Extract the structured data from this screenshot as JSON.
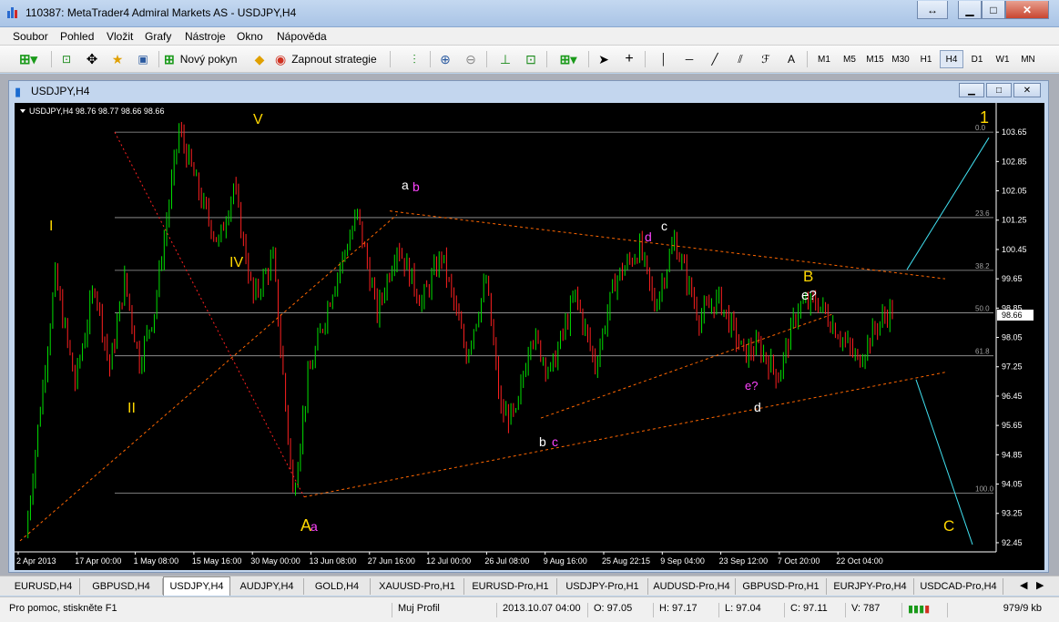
{
  "window": {
    "title": "110387: MetaTrader4 Admiral Markets AS - USDJPY,H4"
  },
  "menu": [
    "Soubor",
    "Pohled",
    "Vložit",
    "Grafy",
    "Nástroje",
    "Okno",
    "Nápověda"
  ],
  "toolbar": {
    "new_order": "Nový pokyn",
    "autotrading": "Zapnout strategie",
    "text_tool": "A",
    "timeframes": [
      "M1",
      "M5",
      "M15",
      "M30",
      "H1",
      "H4",
      "D1",
      "W1",
      "MN"
    ],
    "active_timeframe": "H4"
  },
  "chart_window": {
    "title": "USDJPY,H4"
  },
  "chart_data": {
    "type": "candlestick",
    "header": "USDJPY,H4  98.76 98.77 98.66 98.66",
    "current_price": "98.66",
    "price_ticks": [
      "103.65",
      "102.85",
      "102.05",
      "101.25",
      "100.45",
      "99.65",
      "98.85",
      "98.05",
      "97.25",
      "96.45",
      "95.65",
      "94.85",
      "94.05",
      "93.25",
      "92.45"
    ],
    "ylim": [
      92.2,
      104.2
    ],
    "time_ticks": [
      "2 Apr 2013",
      "17 Apr 00:00",
      "1 May 08:00",
      "15 May 16:00",
      "30 May 00:00",
      "13 Jun 08:00",
      "27 Jun 16:00",
      "12 Jul 00:00",
      "26 Jul 08:00",
      "9 Aug 16:00",
      "25 Aug 22:15",
      "9 Sep 04:00",
      "23 Sep 12:00",
      "7 Oct 20:00",
      "22 Oct 04:00"
    ],
    "fib_levels": [
      {
        "label": "0.0",
        "price": 103.65
      },
      {
        "label": "23.6",
        "price": 101.32
      },
      {
        "label": "38.2",
        "price": 99.88
      },
      {
        "label": "50.0",
        "price": 98.72
      },
      {
        "label": "61.8",
        "price": 97.55
      },
      {
        "label": "100.0",
        "price": 93.8
      }
    ],
    "wave_labels": [
      {
        "text": "V",
        "color": "#ffd700"
      },
      {
        "text": "I",
        "color": "#ffd700"
      },
      {
        "text": "IV",
        "color": "#ffd700"
      },
      {
        "text": "II",
        "color": "#ffd700"
      },
      {
        "text": "A",
        "color": "#ffd700"
      },
      {
        "text": "a",
        "color": "#ff44ff"
      },
      {
        "text": "a",
        "color": "#ffffff"
      },
      {
        "text": "b",
        "color": "#ff44ff"
      },
      {
        "text": "b",
        "color": "#ffffff"
      },
      {
        "text": "c",
        "color": "#ff44ff"
      },
      {
        "text": "d",
        "color": "#ff44ff"
      },
      {
        "text": "c",
        "color": "#ffffff"
      },
      {
        "text": "B",
        "color": "#ffd700"
      },
      {
        "text": "e?",
        "color": "#ffffff"
      },
      {
        "text": "e?",
        "color": "#ff44ff"
      },
      {
        "text": "d",
        "color": "#ffffff"
      },
      {
        "text": "1",
        "color": "#ffd700"
      },
      {
        "text": "C",
        "color": "#ffd700"
      }
    ]
  },
  "tabs": [
    "EURUSD,H4",
    "GBPUSD,H4",
    "USDJPY,H4",
    "AUDJPY,H4",
    "GOLD,H4",
    "XAUUSD-Pro,H1",
    "EURUSD-Pro,H1",
    "USDJPY-Pro,H1",
    "AUDUSD-Pro,H4",
    "GBPUSD-Pro,H1",
    "EURJPY-Pro,H4",
    "USDCAD-Pro,H4"
  ],
  "active_tab": "USDJPY,H4",
  "status": {
    "help": "Pro pomoc, stiskněte F1",
    "profile": "Muj Profil",
    "datetime": "2013.10.07 04:00",
    "open": "O: 97.05",
    "high": "H: 97.17",
    "low": "L: 97.04",
    "close": "C: 97.11",
    "volume": "V: 787",
    "traffic": "979/9 kb"
  },
  "colors": {
    "bull": "#00e000",
    "bear": "#ff2020",
    "grid": "#808080",
    "fib": "#a0a0a0",
    "trend": "#ff6600",
    "channel_line": "#40e0f0"
  }
}
